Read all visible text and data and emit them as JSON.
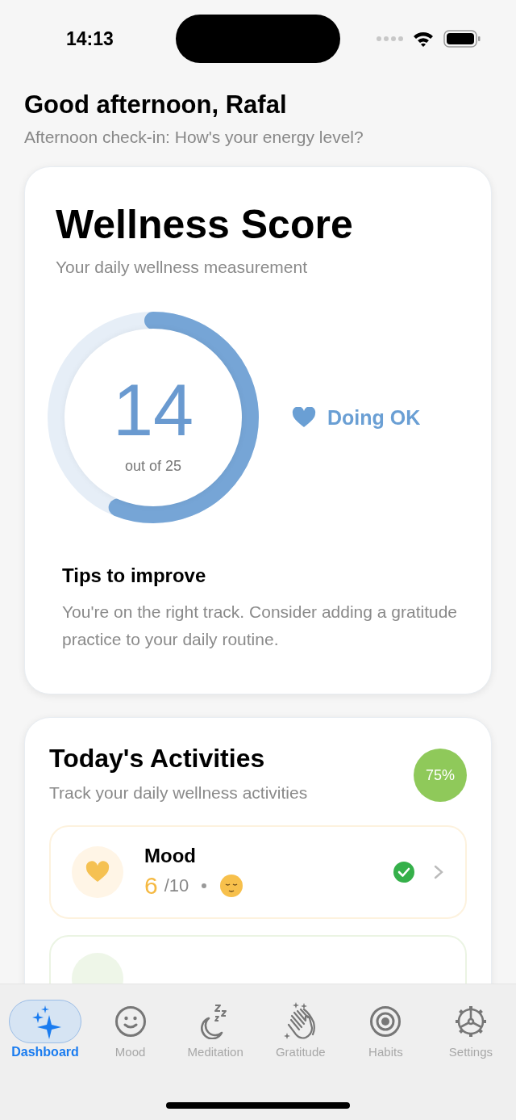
{
  "status_bar": {
    "time": "14:13"
  },
  "header": {
    "greeting": "Good afternoon, Rafal",
    "subtitle": "Afternoon check-in: How's your energy level?"
  },
  "wellness_card": {
    "title": "Wellness Score",
    "subtitle": "Your daily wellness measurement",
    "score": "14",
    "score_caption": "out of 25",
    "level": 0.56,
    "status": "Doing OK",
    "tips_title": "Tips to improve",
    "tips_text": "You're on the right track. Consider adding a gratitude practice to your daily routine."
  },
  "activities_card": {
    "title": "Today's Activities",
    "subtitle": "Track your daily wellness activities",
    "progress": "75%",
    "items": [
      {
        "name": "Mood",
        "value": "6",
        "scale": "/10",
        "completed": true
      }
    ]
  },
  "tabs": [
    {
      "label": "Dashboard",
      "selected": true
    },
    {
      "label": "Mood",
      "selected": false
    },
    {
      "label": "Meditation",
      "selected": false
    },
    {
      "label": "Gratitude",
      "selected": false
    },
    {
      "label": "Habits",
      "selected": false
    },
    {
      "label": "Settings",
      "selected": false
    }
  ]
}
